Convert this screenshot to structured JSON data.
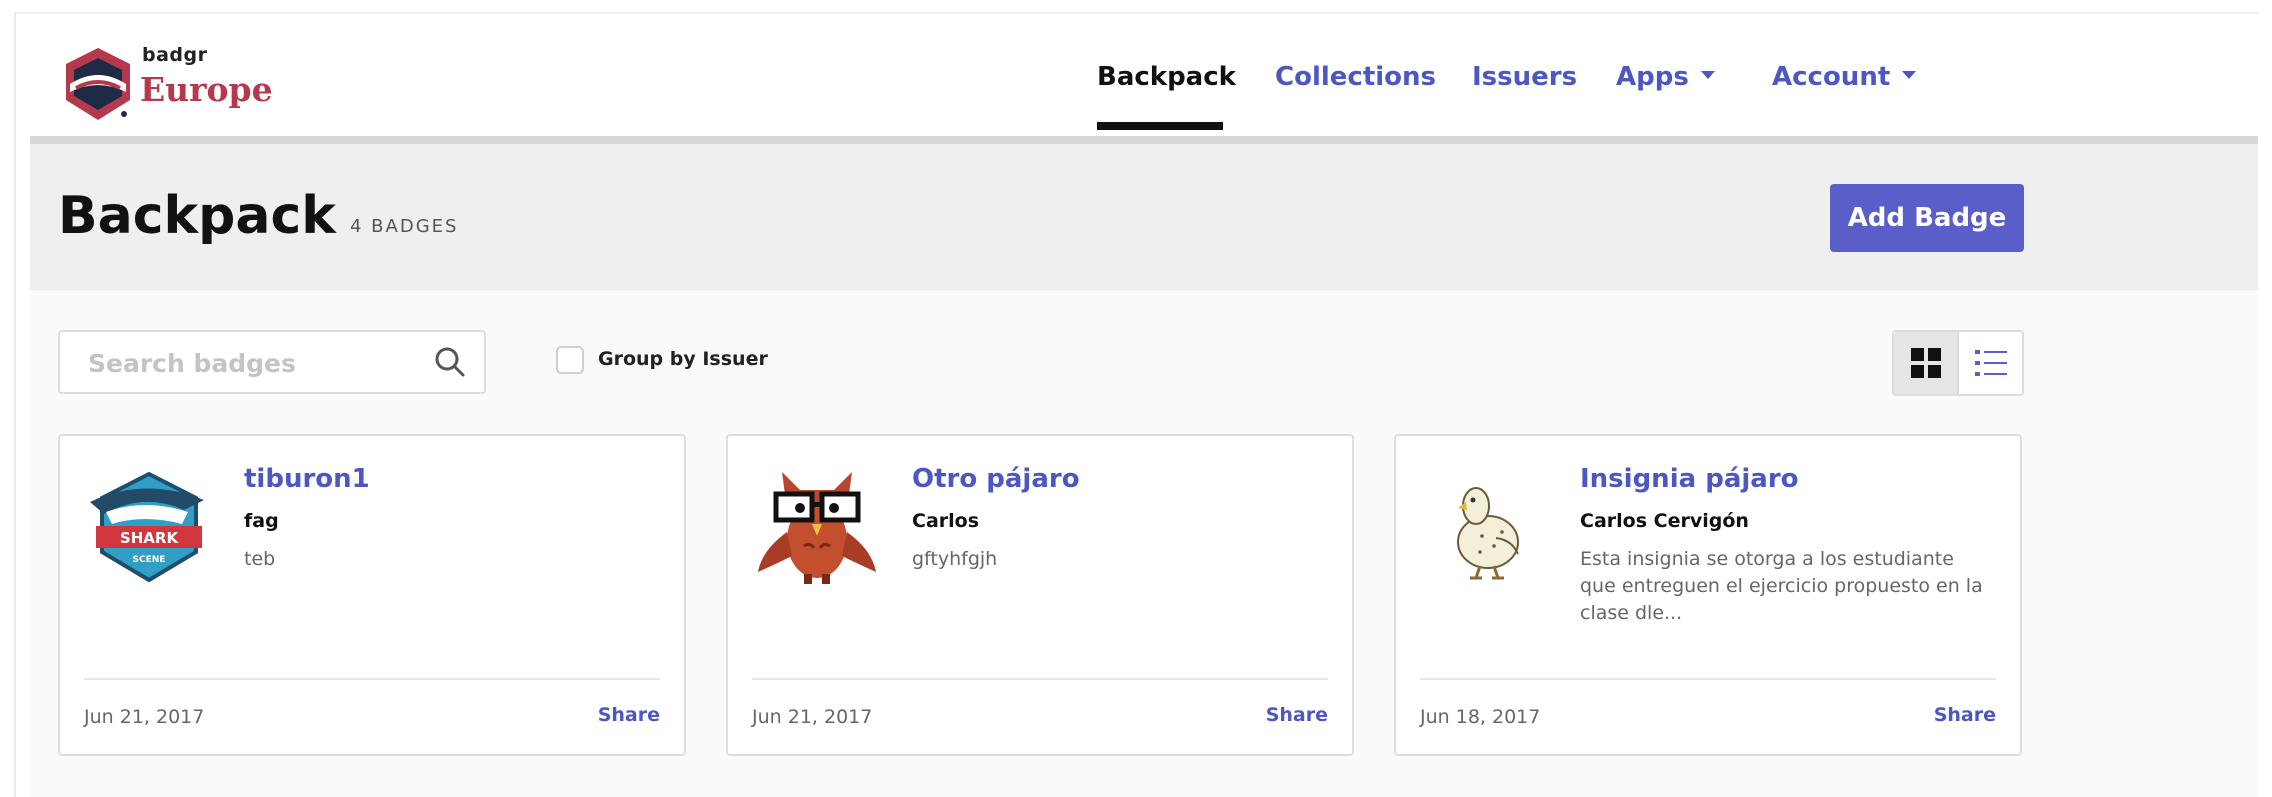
{
  "brand": {
    "logo_top": "badgr",
    "logo_bottom": "Europe",
    "primary_color": "#5a5ec9",
    "brand_color": "#b5394d"
  },
  "nav": {
    "items": [
      {
        "label": "Backpack",
        "active": true
      },
      {
        "label": "Collections",
        "active": false
      },
      {
        "label": "Issuers",
        "active": false
      },
      {
        "label": "Apps",
        "active": false,
        "dropdown": true
      },
      {
        "label": "Account",
        "active": false,
        "dropdown": true
      }
    ]
  },
  "page": {
    "title": "Backpack",
    "badge_count": "4 BADGES",
    "add_badge_label": "Add Badge"
  },
  "toolbar": {
    "search_placeholder": "Search badges",
    "search_value": "",
    "group_by_label": "Group by Issuer",
    "group_by_checked": false,
    "view_mode": "grid"
  },
  "badges": [
    {
      "name": "tiburon1",
      "issuer": "fag",
      "description": "teb",
      "date": "Jun 21, 2017",
      "share_label": "Share",
      "image_icon": "shark-badge-icon",
      "image_text_1": "SHARK",
      "image_text_2": "SCENE"
    },
    {
      "name": "Otro pájaro",
      "issuer": "Carlos",
      "description": "gftyhfgjh",
      "date": "Jun 21, 2017",
      "share_label": "Share",
      "image_icon": "owl-badge-icon"
    },
    {
      "name": "Insignia pájaro",
      "issuer": "Carlos Cervigón",
      "description": "Esta insignia se otorga a los estudiante que entreguen el ejercicio propuesto en la clase dle...",
      "date": "Jun 18, 2017",
      "share_label": "Share",
      "image_icon": "bird-badge-icon"
    }
  ]
}
